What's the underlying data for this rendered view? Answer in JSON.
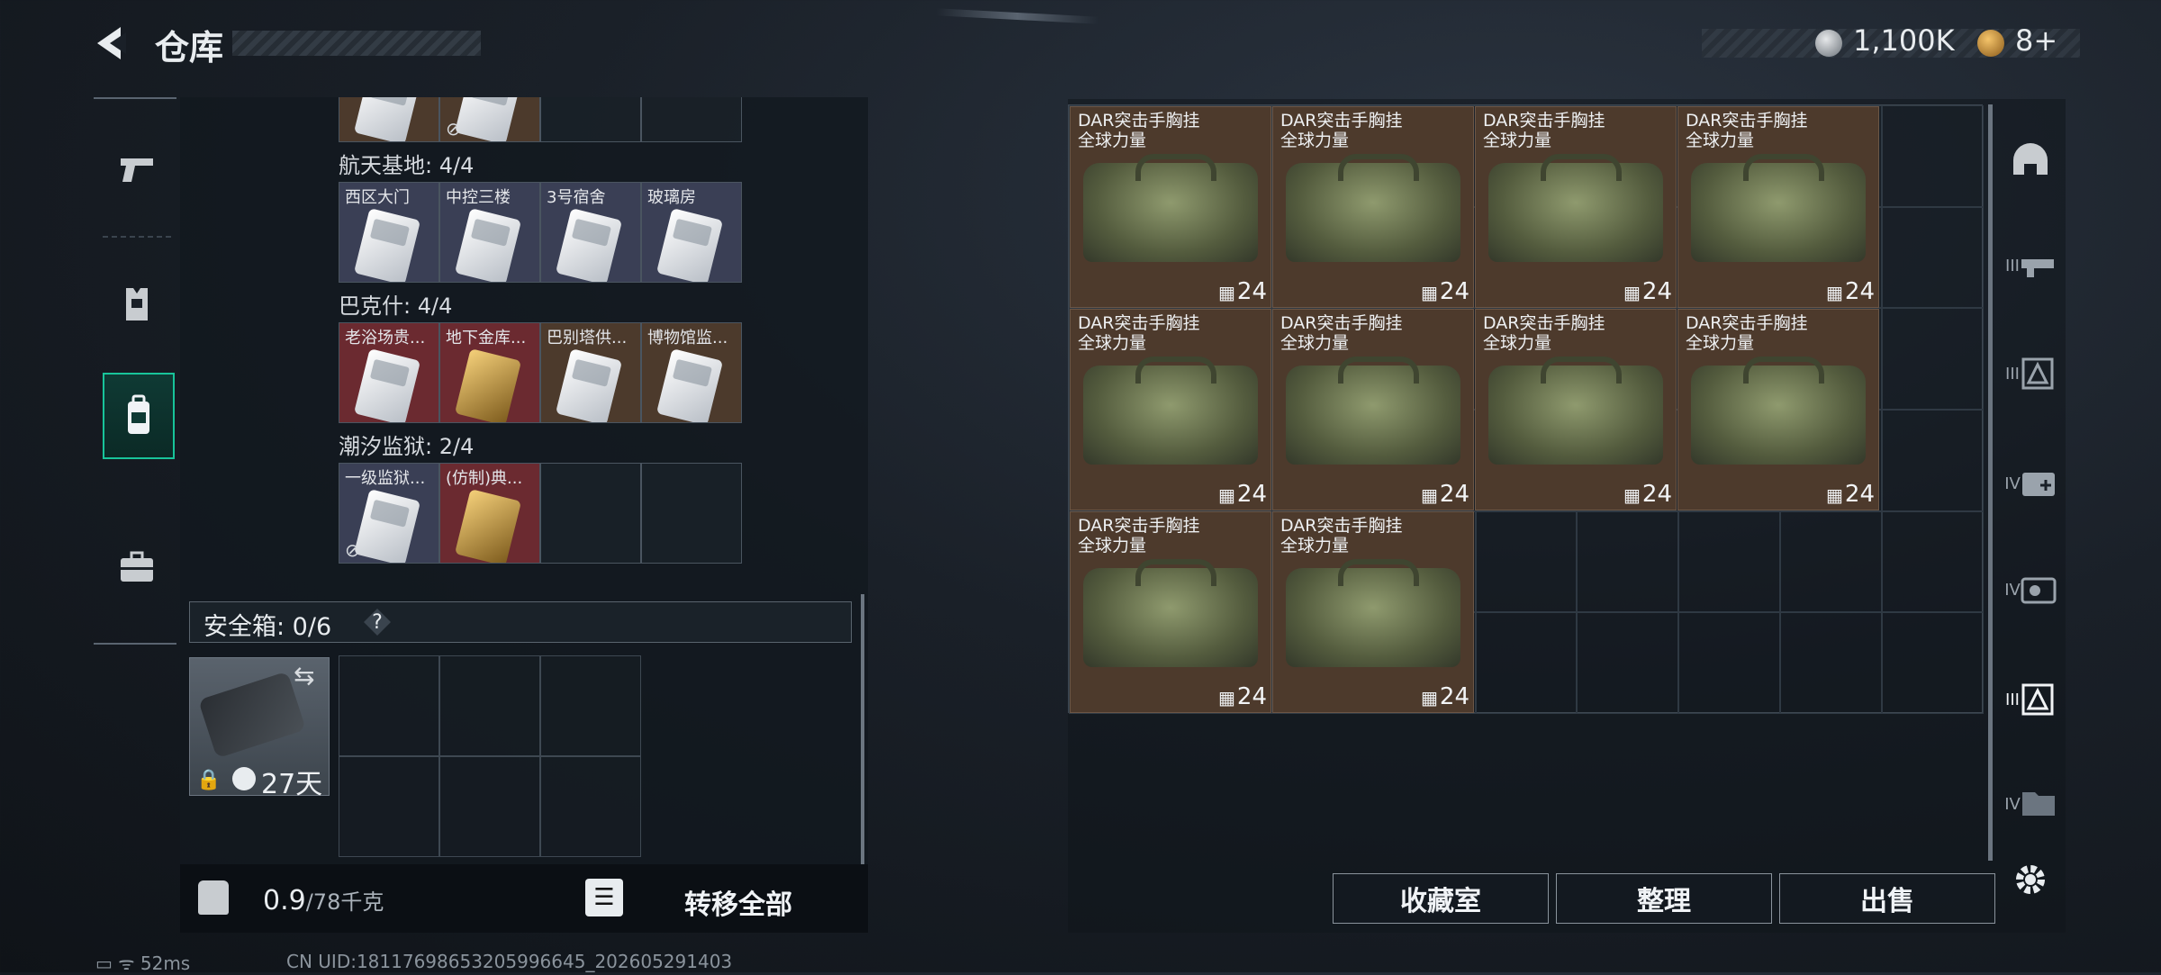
{
  "header": {
    "title": "仓库",
    "currency_silver": "1,100K",
    "currency_gold": "8+"
  },
  "sidebar": {
    "items": [
      {
        "name": "weapons"
      },
      {
        "name": "armor"
      },
      {
        "name": "backpack",
        "active": true
      },
      {
        "name": "toolbox"
      }
    ]
  },
  "keycards": {
    "top_partial": [
      {
        "color": "brown",
        "card": "white"
      },
      {
        "color": "brown",
        "card": "white",
        "nodrop": true
      },
      {
        "color": "empty"
      },
      {
        "color": "empty"
      }
    ],
    "sections": [
      {
        "title": "航天基地: 4/4",
        "cells": [
          {
            "label": "西区大门",
            "color": "blue",
            "card": "white"
          },
          {
            "label": "中控三楼",
            "color": "blue",
            "card": "white"
          },
          {
            "label": "3号宿舍",
            "color": "blue",
            "card": "white"
          },
          {
            "label": "玻璃房",
            "color": "blue",
            "card": "white"
          }
        ]
      },
      {
        "title": "巴克什: 4/4",
        "cells": [
          {
            "label": "老浴场贵...",
            "color": "red",
            "card": "white"
          },
          {
            "label": "地下金库...",
            "color": "red",
            "card": "gold"
          },
          {
            "label": "巴别塔供...",
            "color": "brown",
            "card": "white"
          },
          {
            "label": "博物馆监...",
            "color": "brown",
            "card": "white"
          }
        ]
      },
      {
        "title": "潮汐监狱: 2/4",
        "cells": [
          {
            "label": "一级监狱...",
            "color": "blue",
            "card": "white",
            "nodrop": true
          },
          {
            "label": "(仿制)典...",
            "color": "red",
            "card": "gold"
          },
          {
            "label": "",
            "color": "empty"
          },
          {
            "label": "",
            "color": "empty"
          }
        ]
      }
    ]
  },
  "safe_box": {
    "label": "安全箱: 0/6",
    "help": "?",
    "days": "27天"
  },
  "bottom": {
    "weight_value": "0.9",
    "weight_max": "/78千克",
    "transfer_all": "转移全部"
  },
  "stash": {
    "items": [
      {
        "name_line1": "DAR突击手胸挂",
        "name_line2": "全球力量",
        "qty": "24"
      },
      {
        "name_line1": "DAR突击手胸挂",
        "name_line2": "全球力量",
        "qty": "24"
      },
      {
        "name_line1": "DAR突击手胸挂",
        "name_line2": "全球力量",
        "qty": "24"
      },
      {
        "name_line1": "DAR突击手胸挂",
        "name_line2": "全球力量",
        "qty": "24"
      },
      {
        "name_line1": "DAR突击手胸挂",
        "name_line2": "全球力量",
        "qty": "24"
      },
      {
        "name_line1": "DAR突击手胸挂",
        "name_line2": "全球力量",
        "qty": "24"
      },
      {
        "name_line1": "DAR突击手胸挂",
        "name_line2": "全球力量",
        "qty": "24"
      },
      {
        "name_line1": "DAR突击手胸挂",
        "name_line2": "全球力量",
        "qty": "24"
      },
      {
        "name_line1": "DAR突击手胸挂",
        "name_line2": "全球力量",
        "qty": "24"
      },
      {
        "name_line1": "DAR突击手胸挂",
        "name_line2": "全球力量",
        "qty": "24"
      }
    ]
  },
  "right_sidebar": {
    "tabs": [
      {
        "name": "helmet-tab",
        "text": "⌂"
      },
      {
        "name": "tier3-gun-tab",
        "text": "III"
      },
      {
        "name": "tier3-card-tab",
        "text": "III"
      },
      {
        "name": "tier4-medkit-tab",
        "text": "IV"
      },
      {
        "name": "tier4-key-tab",
        "text": "IV"
      },
      {
        "name": "tier3-active-tab",
        "text": "III",
        "active": true
      },
      {
        "name": "tier4-folder-tab",
        "text": "IV"
      }
    ]
  },
  "actions": {
    "collection": "收藏室",
    "organize": "整理",
    "sell": "出售"
  },
  "status": {
    "ping": "52ms",
    "uid": "CN UID:18117698653205996645_202605291403"
  },
  "colors": {
    "accent": "#18c49a",
    "item_bg": "#4d3a2c",
    "keycard_red": "#6b2a30",
    "keycard_blue": "#3a3f55"
  }
}
